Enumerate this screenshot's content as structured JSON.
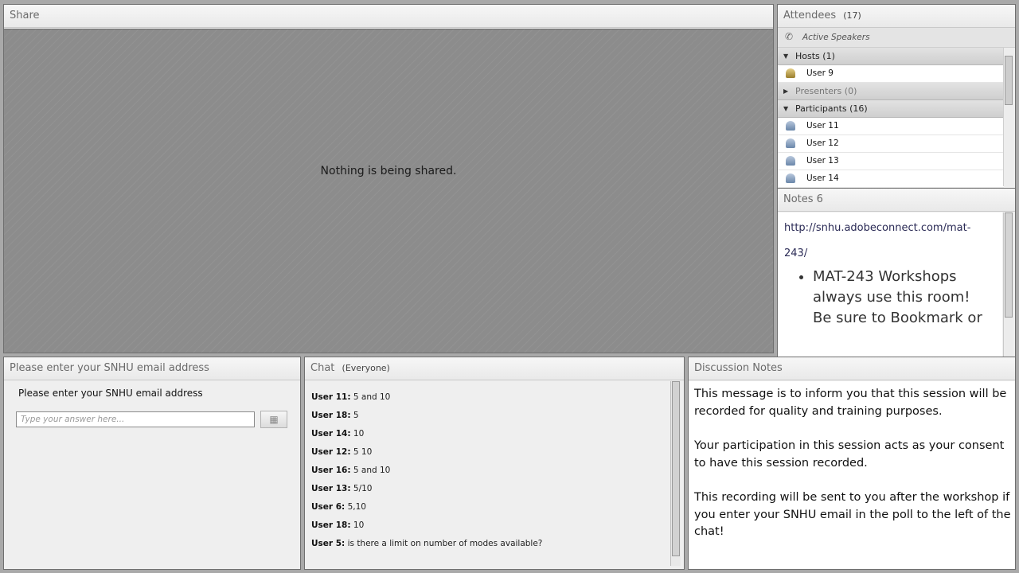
{
  "share": {
    "title": "Share",
    "empty_message": "Nothing is being shared."
  },
  "attendees": {
    "title": "Attendees",
    "count": "(17)",
    "active_speakers": "Active Speakers",
    "groups": [
      {
        "label": "Hosts (1)",
        "users": [
          "User 9"
        ]
      },
      {
        "label": "Presenters (0)",
        "users": []
      },
      {
        "label": "Participants (16)",
        "users": [
          "User 11",
          "User 12",
          "User 13",
          "User 14"
        ]
      }
    ]
  },
  "notes": {
    "title": "Notes 6",
    "link_line1": "http://snhu.adobeconnect.com/mat-",
    "link_line2": "243/",
    "bullet": "MAT-243 Workshops always use this room! Be sure to Bookmark or"
  },
  "poll": {
    "title": "Please enter your SNHU email address",
    "question": "Please enter your SNHU email address",
    "answer_placeholder": "Type your answer here..."
  },
  "chat": {
    "title": "Chat",
    "audience": "(Everyone)",
    "messages": [
      {
        "user": "User 11:",
        "text": "5 and 10"
      },
      {
        "user": "User 18:",
        "text": "5"
      },
      {
        "user": "User 14:",
        "text": "10"
      },
      {
        "user": "User 12:",
        "text": "5 10"
      },
      {
        "user": "User 16:",
        "text": "5 and 10"
      },
      {
        "user": "User 13:",
        "text": "5/10"
      },
      {
        "user": "User 6:",
        "text": "5,10"
      },
      {
        "user": "User 18:",
        "text": "10"
      },
      {
        "user": "User 5:",
        "text": "is there a limit on number of modes available?"
      }
    ]
  },
  "discussion": {
    "title": "Discussion Notes",
    "paragraphs": [
      "This message is to inform you that this session will be recorded for quality and training purposes.",
      "Your participation in this session acts as your consent to have this session recorded.",
      "This recording will be sent to you after the workshop if you enter your SNHU email in the poll to the left of the chat!"
    ]
  }
}
